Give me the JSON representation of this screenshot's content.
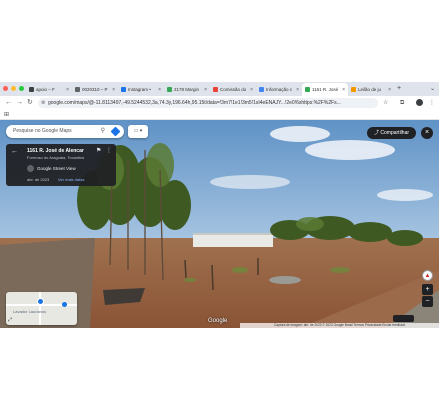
{
  "browser": {
    "tabs": [
      {
        "label": "apoio – F",
        "fav_color": "#3c4043",
        "active": false
      },
      {
        "label": "0020310 – P",
        "fav_color": "#5f6368",
        "active": false
      },
      {
        "label": "Instagram •",
        "fav_color": "#1a73e8",
        "active": false
      },
      {
        "label": "2178 Margin",
        "fav_color": "#34a853",
        "active": false
      },
      {
        "label": "Comissão do",
        "fav_color": "#ea4335",
        "active": false
      },
      {
        "label": "Informação c",
        "fav_color": "#4285f4",
        "active": false
      },
      {
        "label": "1161 R. José",
        "fav_color": "#34a853",
        "active": true
      },
      {
        "label": "Leilão de ju",
        "fav_color": "#f29900",
        "active": false
      }
    ],
    "new_tab": "+",
    "url": "google.com/maps/@-11.8113497,-49.5244532,3a,74.3y,196.64h,95.15t/data=!3m7!1e1!3m5!1sI4eENAJY...!2e0!6shttps:%2F%2Fs...",
    "window_controls_colors": [
      "#ff5f57",
      "#febc2e",
      "#28c840"
    ]
  },
  "maps": {
    "search_placeholder": "Pesquise no Google Maps",
    "share_label": "Compartilhar",
    "info_card": {
      "title": "1161 R. José de Alencar",
      "subtitle": "Formoso do Araguaia, Tocantins",
      "streetview_label": "Google Street View",
      "date": "abr. de 2023",
      "more_dates": "Ver mais datas"
    },
    "minimap_label": "Lavador Laurianos",
    "logo": "Google",
    "footer": "Captura de imagem: abr. de 2023   © 2023 Google   Brasil   Termos   Privacidade   Enviar feedback"
  }
}
